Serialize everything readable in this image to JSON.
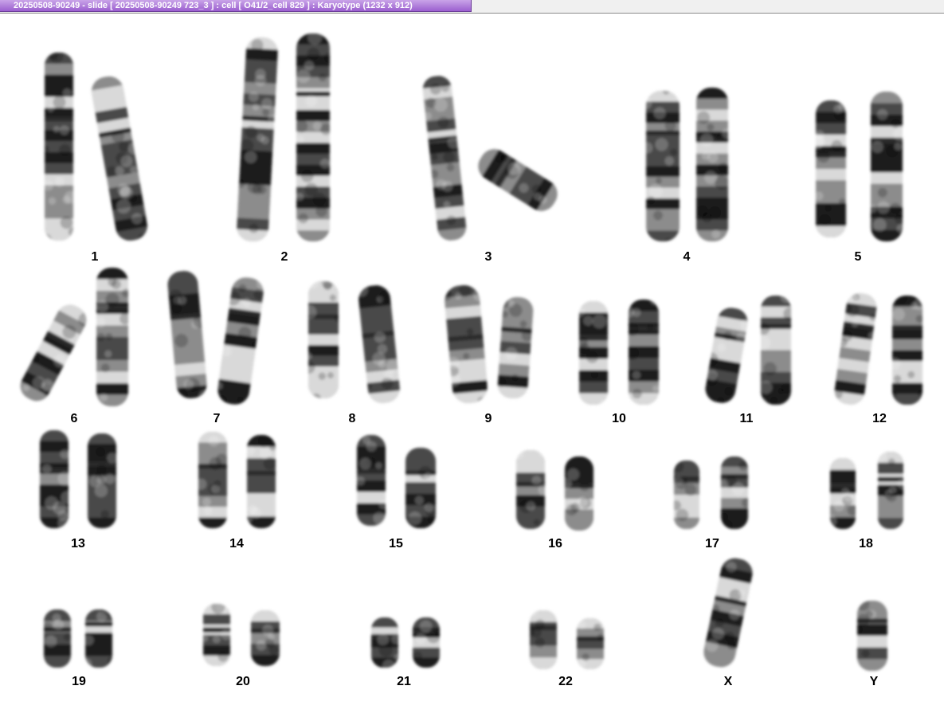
{
  "window": {
    "title": "20250508-90249 - slide [ 20250508-90249 723_3 ] : cell [ O41/2_cell 829 ] : Karyotype  (1232 x 912)"
  },
  "karyotype": {
    "labels": [
      "1",
      "2",
      "3",
      "4",
      "5",
      "6",
      "7",
      "8",
      "9",
      "10",
      "11",
      "12",
      "13",
      "14",
      "15",
      "16",
      "17",
      "18",
      "19",
      "20",
      "21",
      "22",
      "X",
      "Y"
    ]
  }
}
